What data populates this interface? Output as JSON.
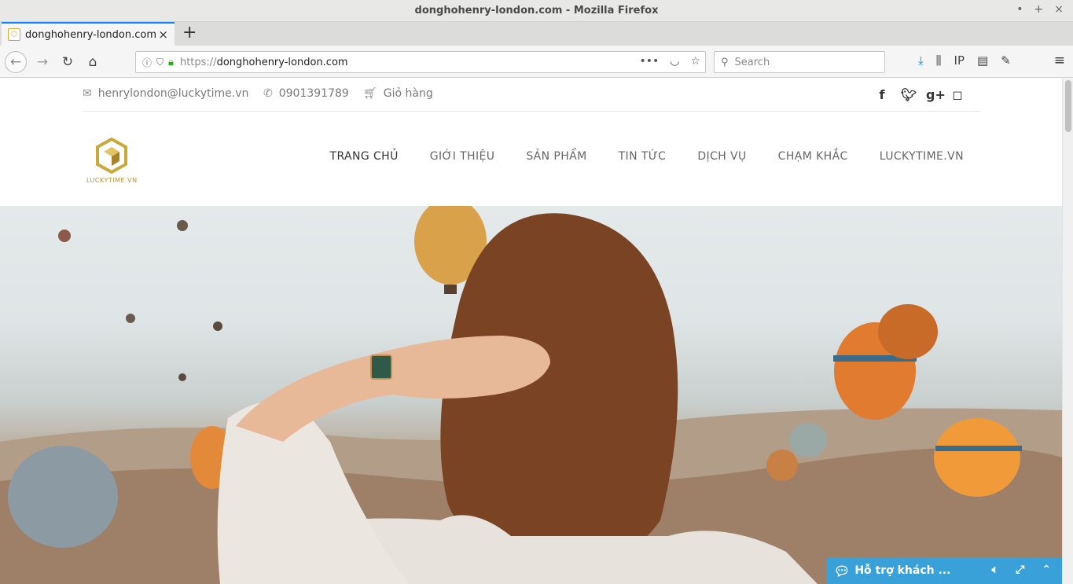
{
  "window": {
    "title": "donghohenry-london.com - Mozilla Firefox",
    "controls": [
      "•",
      "+",
      "×"
    ]
  },
  "tab": {
    "title": "donghohenry-london.com",
    "close_glyph": "×",
    "new_tab_glyph": "+"
  },
  "urlbar": {
    "protocol": "https://",
    "host": "donghohenry-london.com"
  },
  "searchbar": {
    "placeholder": "Search"
  },
  "site": {
    "topbar": {
      "email": "henrylondon@luckytime.vn",
      "phone": "0901391789",
      "cart": "Giỏ hàng"
    },
    "social": [
      "f",
      "t",
      "g+",
      "ig"
    ],
    "logo_text": "LUCKYTIME.VN",
    "nav": [
      "TRANG CHỦ",
      "GIỚI THIỆU",
      "SẢN PHẨM",
      "TIN TỨC",
      "DỊCH VỤ",
      "CHẠM KHẮC",
      "LUCKYTIME.VN"
    ],
    "chat_label": "Hỗ trợ khách ..."
  },
  "colors": {
    "accent": "#0a84ff",
    "brand_gold": "#c9a93a",
    "chat_bg": "#3aa0d8"
  }
}
